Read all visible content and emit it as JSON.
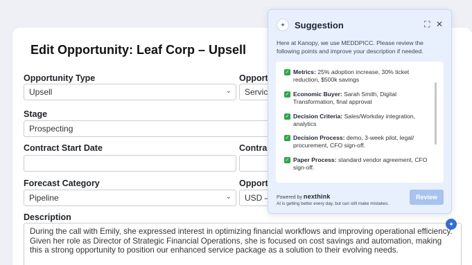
{
  "form": {
    "title": "Edit Opportunity: Leaf Corp – Upsell",
    "opportunity_type": {
      "label": "Opportunity Type",
      "value": "Upsell"
    },
    "right_1": {
      "label": "Opport",
      "value": "Servic"
    },
    "stage": {
      "label": "Stage",
      "value": "Prospecting"
    },
    "contract_start": {
      "label": "Contract Start Date",
      "value": ""
    },
    "right_2": {
      "label": "Contra",
      "value": ""
    },
    "forecast": {
      "label": "Forecast Category",
      "value": "Pipeline"
    },
    "right_3": {
      "label": "Opport",
      "value": "USD –"
    },
    "description": {
      "label": "Description",
      "value": "During the call with Emily, she expressed interest in optimizing financial workflows and improving operational efficiency. Given her role as Director of Strategic Financial Operations, she is focused on cost savings and automation, making this a strong opportunity to position our enhanced service package as a solution to their evolving needs."
    }
  },
  "suggestion": {
    "title": "Suggestion",
    "intro": "Here at Kanopy, we use MEDDPICC. Please review the following points and improve your description if needed.",
    "items": [
      {
        "key": "Metrics:",
        "text": "25% adoption increase, 30% ticket reduction, $500k savings"
      },
      {
        "key": "Economic Buyer:",
        "text": "Sarah Smith, Digital Transformation, final approval"
      },
      {
        "key": "Decision Criteria:",
        "text": "Sales/Workday integration, analytics"
      },
      {
        "key": "Decision Process:",
        "text": "demo, 3-week pilot, legal/ procurement, CFO sign-off."
      },
      {
        "key": "Paper Process:",
        "text": "standard vendor agreement, CFO sign-off."
      }
    ],
    "powered_by": "Powered by",
    "brand": "nexthink",
    "disclaimer": "AI is getting better every day, but can still make mistakes.",
    "review_label": "Review",
    "expand_icon": "⛶",
    "close_icon": "✕"
  }
}
